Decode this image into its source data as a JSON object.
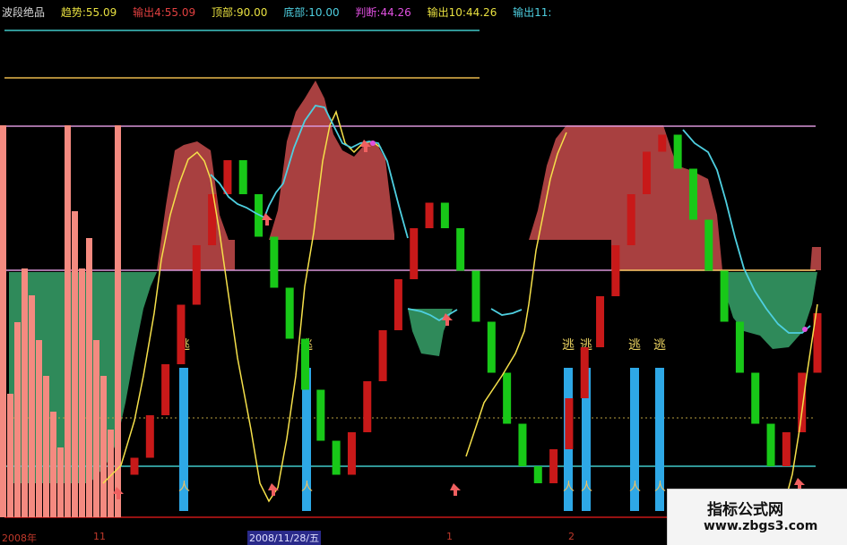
{
  "header": {
    "name": "波段绝品",
    "trend": "趋势:55.09",
    "output1": "输出4:55.09",
    "top": "顶部:90.00",
    "bottom": "底部:10.00",
    "judge": "判断:44.26",
    "output2": "输出10:44.26",
    "output3": "输出11:"
  },
  "x_axis": {
    "label_2008": "2008年",
    "label_11": "11",
    "label_date": "2008/11/28/五",
    "label_1": "1",
    "label_2": "2"
  },
  "markers": {
    "escape": "逃"
  },
  "watermark": {
    "line1": "指标公式网",
    "line2": "www.zbgs3.com"
  },
  "colors": {
    "up": "#c81919",
    "down": "#18c818",
    "escape_bar": "#2ea8e6",
    "red_area": "#a84040",
    "green_area": "#2f8a5a",
    "salmon": "#f48a80",
    "yellow_line": "#f5e04a",
    "cyan_line": "#4ecfe0",
    "guide_top": "#e8b84a",
    "guide_mid": "#d896d8",
    "guide_low": "#40c8c8"
  },
  "chart_data": {
    "type": "candlestick",
    "ylim": [
      0,
      100
    ],
    "reference_levels": {
      "top": 90,
      "bottom": 10,
      "mid": 50
    },
    "candles": [
      {
        "open": 8,
        "close": 12
      },
      {
        "open": 12,
        "close": 22
      },
      {
        "open": 22,
        "close": 34
      },
      {
        "open": 34,
        "close": 48
      },
      {
        "open": 48,
        "close": 62
      },
      {
        "open": 62,
        "close": 74
      },
      {
        "open": 74,
        "close": 82
      },
      {
        "open": 82,
        "close": 74
      },
      {
        "open": 74,
        "close": 64
      },
      {
        "open": 64,
        "close": 52
      },
      {
        "open": 52,
        "close": 40
      },
      {
        "open": 40,
        "close": 28
      },
      {
        "open": 28,
        "close": 16
      },
      {
        "open": 16,
        "close": 8
      },
      {
        "open": 8,
        "close": 18
      },
      {
        "open": 18,
        "close": 30
      },
      {
        "open": 30,
        "close": 42
      },
      {
        "open": 42,
        "close": 54
      },
      {
        "open": 54,
        "close": 66
      },
      {
        "open": 66,
        "close": 72
      },
      {
        "open": 72,
        "close": 66
      },
      {
        "open": 66,
        "close": 56
      },
      {
        "open": 56,
        "close": 44
      },
      {
        "open": 44,
        "close": 32
      },
      {
        "open": 32,
        "close": 20
      },
      {
        "open": 20,
        "close": 10
      },
      {
        "open": 10,
        "close": 6
      },
      {
        "open": 6,
        "close": 14
      },
      {
        "open": 14,
        "close": 26
      },
      {
        "open": 26,
        "close": 38
      },
      {
        "open": 38,
        "close": 50
      },
      {
        "open": 50,
        "close": 62
      },
      {
        "open": 62,
        "close": 74
      },
      {
        "open": 74,
        "close": 84
      },
      {
        "open": 84,
        "close": 88
      },
      {
        "open": 88,
        "close": 80
      },
      {
        "open": 80,
        "close": 68
      },
      {
        "open": 68,
        "close": 56
      },
      {
        "open": 56,
        "close": 44
      },
      {
        "open": 44,
        "close": 32
      },
      {
        "open": 32,
        "close": 20
      },
      {
        "open": 20,
        "close": 10
      },
      {
        "open": 10,
        "close": 18
      },
      {
        "open": 18,
        "close": 32
      },
      {
        "open": 32,
        "close": 46
      }
    ],
    "escape_signals": [
      8,
      15,
      34,
      35,
      38,
      39
    ]
  }
}
